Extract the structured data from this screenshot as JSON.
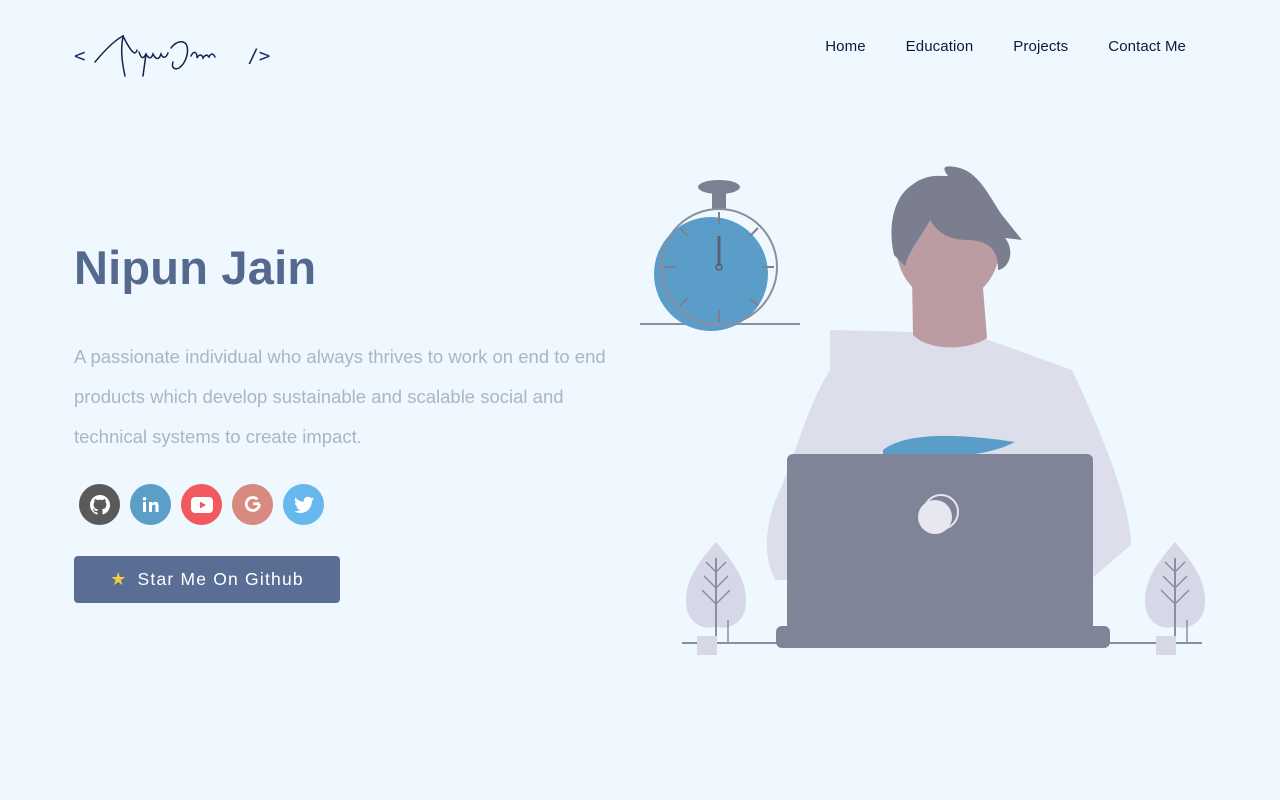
{
  "header": {
    "logo": {
      "open": "<",
      "close": "/>",
      "name": "Nipun Jain"
    },
    "nav": [
      {
        "label": "Home"
      },
      {
        "label": "Education"
      },
      {
        "label": "Projects"
      },
      {
        "label": "Contact Me"
      }
    ]
  },
  "hero": {
    "title": "Nipun Jain",
    "subtitle": "A passionate individual who always thrives to work on end to end products which develop sustainable and scalable social and technical systems to create impact.",
    "cta_icon": "★",
    "cta_label": "Star Me On Github"
  },
  "socials": [
    {
      "icon": "github-icon",
      "color": "#5a5a5a"
    },
    {
      "icon": "linkedin-icon",
      "color": "#5b9fc9"
    },
    {
      "icon": "youtube-icon",
      "color": "#f05a5f"
    },
    {
      "icon": "google-icon",
      "color": "#d98a80"
    },
    {
      "icon": "twitter-icon",
      "color": "#67b8ee"
    }
  ],
  "colors": {
    "background": "#eef8fe",
    "title": "#55698f",
    "subtitle": "#aab5c7",
    "button": "#5a6d95",
    "accent": "#5b9dc9"
  }
}
